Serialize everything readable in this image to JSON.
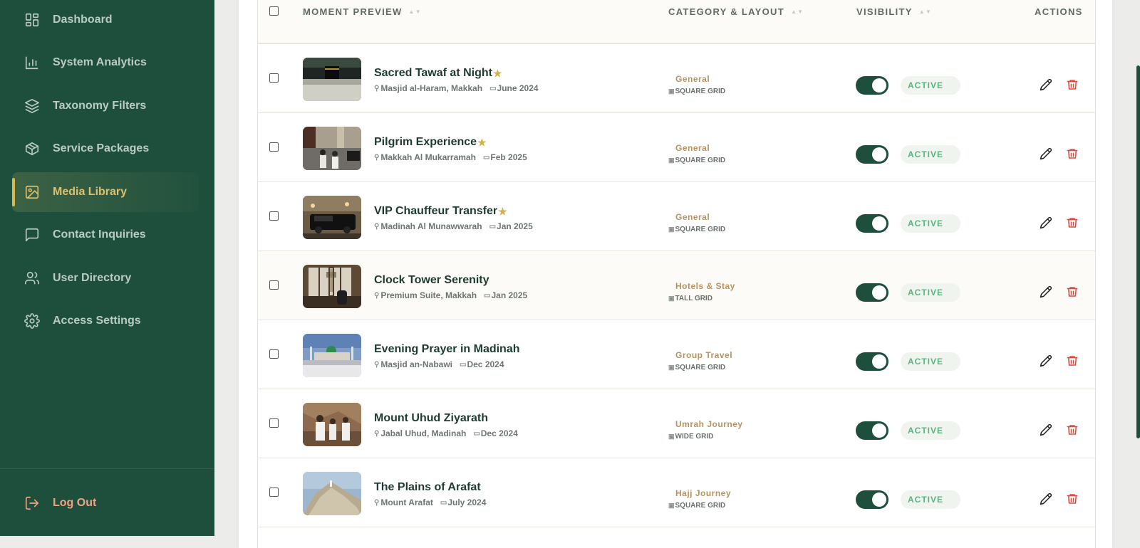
{
  "sidebar": {
    "items": [
      {
        "label": "Dashboard",
        "icon": "dashboard-icon"
      },
      {
        "label": "System Analytics",
        "icon": "bar-chart-icon"
      },
      {
        "label": "Taxonomy Filters",
        "icon": "layers-icon"
      },
      {
        "label": "Service Packages",
        "icon": "package-icon"
      },
      {
        "label": "Media Library",
        "icon": "image-icon",
        "active": true
      },
      {
        "label": "Contact Inquiries",
        "icon": "message-icon"
      },
      {
        "label": "User Directory",
        "icon": "users-icon"
      },
      {
        "label": "Access Settings",
        "icon": "gear-icon"
      }
    ],
    "logout_label": "Log Out"
  },
  "table": {
    "headers": {
      "preview": "MOMENT PREVIEW",
      "category": "CATEGORY & LAYOUT",
      "visibility": "VISIBILITY",
      "actions": "ACTIONS"
    },
    "rows": [
      {
        "title": "Sacred Tawaf at Night",
        "featured": true,
        "location": "Masjid al-Haram, Makkah",
        "date": "June 2024",
        "category": "General",
        "layout": "SQUARE GRID",
        "status": "ACTIVE"
      },
      {
        "title": "Pilgrim Experience",
        "featured": true,
        "location": "Makkah Al Mukarramah",
        "date": "Feb 2025",
        "category": "General",
        "layout": "SQUARE GRID",
        "status": "ACTIVE"
      },
      {
        "title": "VIP Chauffeur Transfer",
        "featured": true,
        "location": "Madinah Al Munawwarah",
        "date": "Jan 2025",
        "category": "General",
        "layout": "SQUARE GRID",
        "status": "ACTIVE"
      },
      {
        "title": "Clock Tower Serenity",
        "featured": false,
        "location": "Premium Suite, Makkah",
        "date": "Jan 2025",
        "category": "Hotels & Stay",
        "layout": "TALL GRID",
        "status": "ACTIVE"
      },
      {
        "title": "Evening Prayer in Madinah",
        "featured": false,
        "location": "Masjid an-Nabawi",
        "date": "Dec 2024",
        "category": "Group Travel",
        "layout": "SQUARE GRID",
        "status": "ACTIVE"
      },
      {
        "title": "Mount Uhud Ziyarath",
        "featured": false,
        "location": "Jabal Uhud, Madinah",
        "date": "Dec 2024",
        "category": "Umrah Journey",
        "layout": "WIDE GRID",
        "status": "ACTIVE"
      },
      {
        "title": "The Plains of Arafat",
        "featured": false,
        "location": "Mount Arafat",
        "date": "July 2024",
        "category": "Hajj Journey",
        "layout": "SQUARE GRID",
        "status": "ACTIVE"
      }
    ]
  },
  "colors": {
    "sidebar_bg": "#1e4f3d",
    "accent_gold": "#d9b84e",
    "active_badge_text": "#58b57e",
    "delete_red": "#e0483e",
    "logout_text": "#f2a283"
  }
}
